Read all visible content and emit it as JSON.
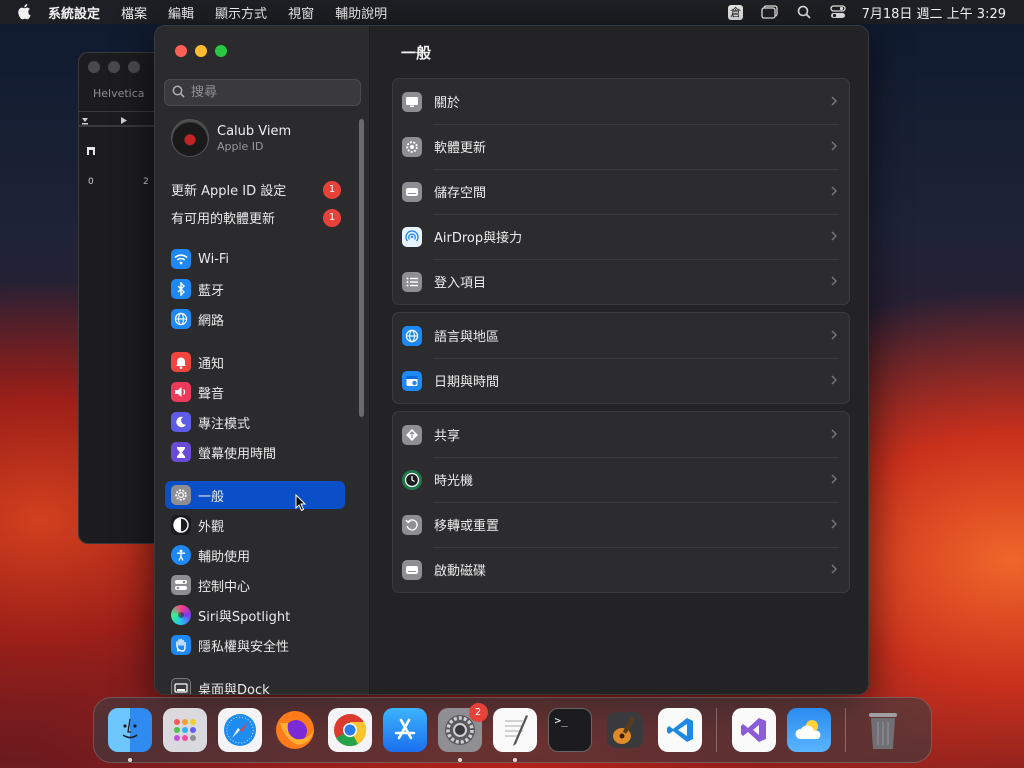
{
  "menubar": {
    "app_name": "系統設定",
    "menus": [
      "檔案",
      "編輯",
      "顯示方式",
      "視窗",
      "輔助說明"
    ],
    "clock": "7月18日 週二 上午 3:29",
    "input_method_glyph": "倉"
  },
  "background_window": {
    "font_name": "Helvetica",
    "ruler_start": "0",
    "ruler_mark": "2"
  },
  "sidebar": {
    "search_placeholder": "搜尋",
    "profile": {
      "name": "Calub Viem",
      "subtitle": "Apple ID"
    },
    "notices": [
      {
        "label": "更新 Apple ID 設定",
        "count": "1"
      },
      {
        "label": "有可用的軟體更新",
        "count": "1"
      }
    ],
    "items": [
      {
        "label": "Wi-Fi",
        "icon": "wifi-icon",
        "color": "#1e88f5"
      },
      {
        "label": "藍牙",
        "icon": "bluetooth-icon",
        "color": "#1e88f5"
      },
      {
        "label": "網路",
        "icon": "globe-icon",
        "color": "#1e88f5"
      },
      {
        "label": "通知",
        "icon": "bell-icon",
        "color": "#f0443e"
      },
      {
        "label": "聲音",
        "icon": "speaker-icon",
        "color": "#ee3a5a"
      },
      {
        "label": "專注模式",
        "icon": "moon-icon",
        "color": "#5e5ce6"
      },
      {
        "label": "螢幕使用時間",
        "icon": "hourglass-icon",
        "color": "#6a4bd8"
      },
      {
        "label": "一般",
        "icon": "gear-icon",
        "color": "#8e8e93"
      },
      {
        "label": "外觀",
        "icon": "appearance-icon",
        "color": "#1c1c1e"
      },
      {
        "label": "輔助使用",
        "icon": "accessibility-icon",
        "color": "#1e88f5"
      },
      {
        "label": "控制中心",
        "icon": "toggles-icon",
        "color": "#8e8e93"
      },
      {
        "label": "Siri與Spotlight",
        "icon": "siri-icon",
        "color": "#7a3cf0"
      },
      {
        "label": "隱私權與安全性",
        "icon": "hand-icon",
        "color": "#1e88f5"
      },
      {
        "label": "桌面與Dock",
        "icon": "dock-icon",
        "color": "#3a3a3c"
      }
    ],
    "active_label": "一般"
  },
  "main": {
    "title": "一般",
    "groups": [
      [
        {
          "label": "關於",
          "icon": "display-icon"
        },
        {
          "label": "軟體更新",
          "icon": "gear-badge-icon"
        },
        {
          "label": "儲存空間",
          "icon": "drive-icon"
        },
        {
          "label": "AirDrop與接力",
          "icon": "airdrop-icon"
        },
        {
          "label": "登入項目",
          "icon": "list-icon"
        }
      ],
      [
        {
          "label": "語言與地區",
          "icon": "globe-icon"
        },
        {
          "label": "日期與時間",
          "icon": "calendar-icon"
        }
      ],
      [
        {
          "label": "共享",
          "icon": "sharing-icon"
        },
        {
          "label": "時光機",
          "icon": "time-machine-icon"
        },
        {
          "label": "移轉或重置",
          "icon": "reset-icon"
        },
        {
          "label": "啟動磁碟",
          "icon": "drive-icon"
        }
      ]
    ]
  },
  "dock": {
    "apps": [
      {
        "name": "finder-icon",
        "running": true
      },
      {
        "name": "launchpad-icon",
        "running": false
      },
      {
        "name": "safari-icon",
        "running": false
      },
      {
        "name": "firefox-icon",
        "running": false
      },
      {
        "name": "chrome-icon",
        "running": false
      },
      {
        "name": "app-store-icon",
        "running": false
      },
      {
        "name": "system-settings-icon",
        "running": true,
        "badge": "2"
      },
      {
        "name": "textedit-icon",
        "running": true
      },
      {
        "name": "terminal-icon",
        "running": false
      },
      {
        "name": "garageband-icon",
        "running": false
      },
      {
        "name": "vscode-icon",
        "running": false
      },
      {
        "name": "visual-studio-icon",
        "running": false
      },
      {
        "name": "weather-icon",
        "running": false
      },
      {
        "name": "trash-icon",
        "running": false
      }
    ],
    "terminal_prompt": ">_"
  }
}
